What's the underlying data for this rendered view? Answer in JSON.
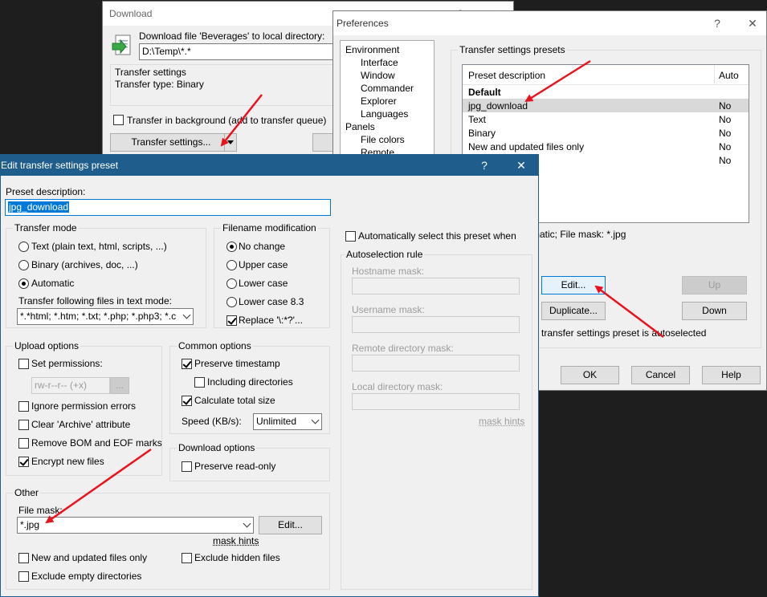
{
  "download_dialog": {
    "title": "Download",
    "help": "?",
    "close": "✕",
    "prompt": "Download file 'Beverages' to local directory:",
    "path_value": "D:\\Temp\\*.*",
    "transfer_settings_heading": "Transfer settings",
    "transfer_type": "Transfer type: Binary",
    "background_label": "Transfer in background (add to transfer queue)",
    "transfer_settings_button": "Transfer settings..."
  },
  "preferences": {
    "title": "Preferences",
    "help": "?",
    "close": "✕",
    "tree": [
      {
        "label": "Environment",
        "level": 0
      },
      {
        "label": "Interface",
        "level": 1
      },
      {
        "label": "Window",
        "level": 1
      },
      {
        "label": "Commander",
        "level": 1
      },
      {
        "label": "Explorer",
        "level": 1
      },
      {
        "label": "Languages",
        "level": 1
      },
      {
        "label": "Panels",
        "level": 0
      },
      {
        "label": "File colors",
        "level": 1
      },
      {
        "label": "Remote",
        "level": 1
      }
    ],
    "presets_group": "Transfer settings presets",
    "col_desc": "Preset description",
    "col_auto": "Auto",
    "presets": [
      {
        "desc": "Default",
        "auto": ""
      },
      {
        "desc": "jpg_download",
        "auto": "No"
      },
      {
        "desc": "Text",
        "auto": "No"
      },
      {
        "desc": "Binary",
        "auto": "No"
      },
      {
        "desc": "New and updated files only",
        "auto": "No"
      },
      {
        "desc": "",
        "auto": "No"
      }
    ],
    "summary": "matic; File mask: *.jpg",
    "edit_button": "Edit...",
    "up_button": "Up",
    "duplicate_button": "Duplicate...",
    "down_button": "Down",
    "autoselect_note": "transfer settings preset is autoselected",
    "ok_button": "OK",
    "cancel_button": "Cancel",
    "help_button": "Help"
  },
  "edit_preset": {
    "title": "Edit transfer settings preset",
    "help": "?",
    "close": "✕",
    "preset_desc_label": "Preset description:",
    "preset_desc_value": "jpg_download",
    "transfer_mode": {
      "label": "Transfer mode",
      "text_option": "Text (plain text, html, scripts, ...)",
      "binary_option": "Binary (archives, doc, ...)",
      "automatic_option": "Automatic",
      "text_mode_label": "Transfer following files in text mode:",
      "text_mode_value": "*.*html; *.htm; *.txt; *.php; *.php3; *.c"
    },
    "filename_mod": {
      "label": "Filename modification",
      "no_change": "No change",
      "upper": "Upper case",
      "lower": "Lower case",
      "lower83": "Lower case 8.3",
      "replace": "Replace '\\:*?'..."
    },
    "upload": {
      "label": "Upload options",
      "set_permissions": "Set permissions:",
      "permissions_value": "rw-r--r-- (+x)",
      "permissions_btn": "...",
      "ignore_errors": "Ignore permission errors",
      "clear_archive": "Clear 'Archive' attribute",
      "remove_bom": "Remove BOM and EOF marks",
      "encrypt": "Encrypt new files"
    },
    "common": {
      "label": "Common options",
      "preserve_ts": "Preserve timestamp",
      "including_dirs": "Including directories",
      "calc_size": "Calculate total size",
      "speed_label": "Speed (KB/s):",
      "speed_value": "Unlimited"
    },
    "download": {
      "label": "Download options",
      "preserve_ro": "Preserve read-only"
    },
    "other": {
      "label": "Other",
      "file_mask_label": "File mask:",
      "file_mask_value": "*.jpg",
      "edit_btn": "Edit...",
      "mask_hints": "mask hints",
      "new_updated": "New and updated files only",
      "exclude_hidden": "Exclude hidden files",
      "exclude_empty": "Exclude empty directories"
    },
    "auto_select": "Automatically select this preset when",
    "autoselection": {
      "label": "Autoselection rule",
      "hostname": "Hostname mask:",
      "username": "Username mask:",
      "remote_dir": "Remote directory mask:",
      "local_dir": "Local directory mask:",
      "mask_hints": "mask hints"
    }
  },
  "colors": {
    "titlebar_active": "#1f5d8c",
    "selection": "#0078d7",
    "arrow": "#e8131c"
  }
}
